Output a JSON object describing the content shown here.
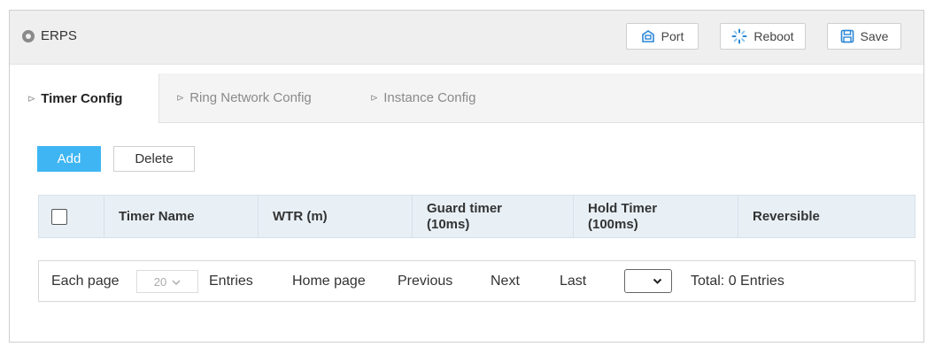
{
  "header": {
    "title": "ERPS",
    "buttons": {
      "port": "Port",
      "reboot": "Reboot",
      "save": "Save"
    }
  },
  "tabs": [
    {
      "label": "Timer Config",
      "active": true
    },
    {
      "label": "Ring Network Config",
      "active": false
    },
    {
      "label": "Instance Config",
      "active": false
    }
  ],
  "actions": {
    "add": "Add",
    "delete": "Delete"
  },
  "table": {
    "columns": [
      "Timer Name",
      "WTR (m)",
      "Guard timer (10ms)",
      "Hold Timer (100ms)",
      "Reversible"
    ],
    "rows": []
  },
  "pager": {
    "each_page": "Each page",
    "page_size": "20",
    "entries": "Entries",
    "home": "Home page",
    "previous": "Previous",
    "next": "Next",
    "last": "Last",
    "current_page": "",
    "total": "Total: 0 Entries"
  },
  "colors": {
    "accent": "#3fb6f3",
    "icon_blue": "#2b86d6",
    "table_header_bg": "#e8f0f6"
  },
  "icons": {
    "title": "circle-bullet-icon",
    "port": "port-icon",
    "reboot": "reboot-spinner-icon",
    "save": "save-floppy-icon"
  }
}
